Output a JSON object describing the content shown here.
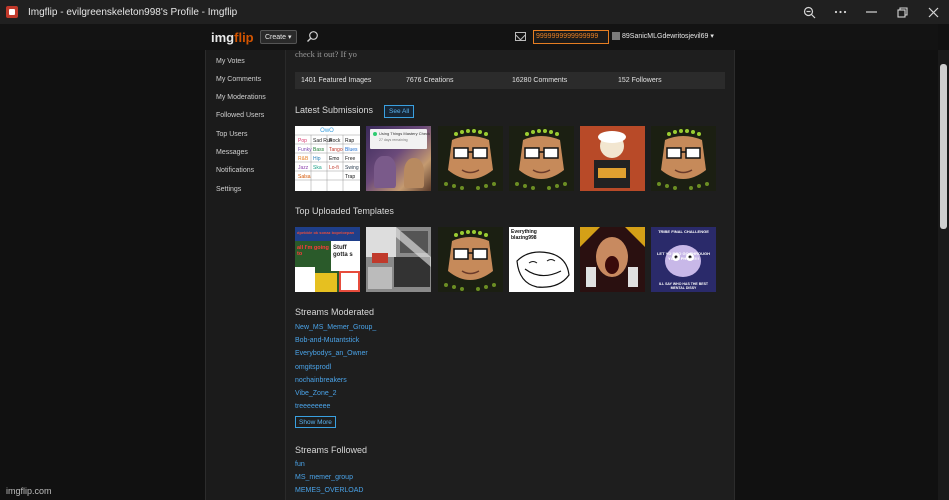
{
  "window": {
    "title": "Imgflip - evilgreenskeleton998's Profile - Imgflip",
    "actions": [
      "zoom-out-icon",
      "more-icon",
      "restore-icon",
      "close-icon"
    ]
  },
  "header": {
    "logo_img": "img",
    "logo_flip": "flip",
    "create_label": "Create",
    "points": "9999999999999999",
    "username": "89SanicMLGdewritosjevil69"
  },
  "sidebar": {
    "items": [
      "My Votes",
      "My Comments",
      "My Moderations",
      "Followed Users",
      "Top Users",
      "Messages",
      "Notifications",
      "Settings"
    ]
  },
  "profile": {
    "bio_fragment": "check it out? If yo",
    "stats": {
      "featured": "1401 Featured Images",
      "creations": "7676 Creations",
      "comments": "16280 Comments",
      "followers": "152 Followers"
    }
  },
  "latest": {
    "title": "Latest Submissions",
    "see_all": "See All",
    "thumb1_title": "OwO",
    "thumb1_cells": [
      "Pop",
      "Sad Ruh",
      "Rock",
      "Rap",
      "Funky",
      "Bass",
      "Tango",
      "Blues",
      "R&B",
      "Hip",
      "Emo",
      "Free",
      "Jazz",
      "Ska",
      "Lo-fi",
      "Swing",
      "Salsa",
      "Trap"
    ],
    "thumb2_caption": "Using Things Mastery Check",
    "thumb2_sub": "27 days remaining"
  },
  "templates": {
    "title": "Top Uploaded Templates",
    "thumb1_top": "dpebble ok sonaz bopeloepan",
    "thumb1_mid": "Stuff gotta s",
    "thumb1_left": "all I'm going to",
    "thumb4_text": "Everything blazing998",
    "thumb6_top": "TRIBE FINAL CHALLENGE",
    "thumb6_mid": "LET YO BRO GO THROUGH YOUR PHONE!!!",
    "thumb6_bottom": "ILL SAY WHO HAS THE BEST MENTAL DISSY"
  },
  "moderated": {
    "title": "Streams Moderated",
    "items": [
      "New_MS_Memer_Group_",
      "Bob-and-Mutantstick",
      "Everybodys_an_Owner",
      "omgitsprodl",
      "nochainbreakers",
      "Vibe_Zone_2",
      "treeeeeeee"
    ],
    "show_more": "Show More"
  },
  "followed": {
    "title": "Streams Followed",
    "items": [
      "fun",
      "MS_memer_group",
      "MEMES_OVERLOAD"
    ]
  },
  "watermark": "imgflip.com"
}
